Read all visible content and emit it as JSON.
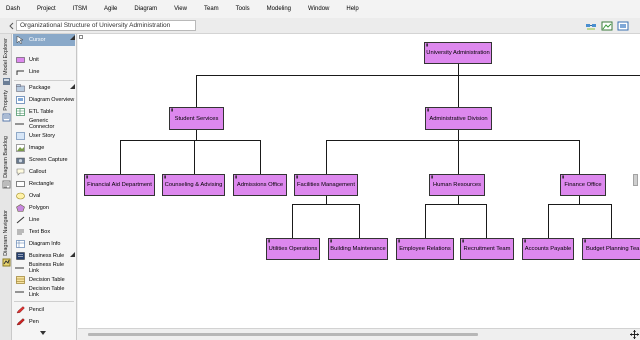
{
  "menu": [
    "Dash",
    "Project",
    "ITSM",
    "Agile",
    "Diagram",
    "View",
    "Team",
    "Tools",
    "Modeling",
    "Window",
    "Help"
  ],
  "diagram_title": "Organizational Structure of University Administration",
  "side_tabs": [
    "Model Explorer",
    "Property",
    "Diagram Backlog",
    "Diagram Navigator"
  ],
  "palette": {
    "selected": "Cursor",
    "items": [
      "Cursor",
      "Unit",
      "Line",
      "Package",
      "Diagram Overview",
      "ETL Table",
      "Generic Connector",
      "User Story",
      "Image",
      "Screen Capture",
      "Callout",
      "Rectangle",
      "Oval",
      "Polygon",
      "Line",
      "Text Box",
      "Diagram Info",
      "Business Rule",
      "Business Rule Link",
      "Decision Table",
      "Decision Table Link",
      "Pencil",
      "Pen"
    ]
  },
  "colors": {
    "unit_fill": "#dd88ee",
    "selected": "#8aa9c9"
  },
  "org": {
    "root": "University Administration",
    "divisions": [
      "Student Services",
      "Administrative Division"
    ],
    "student_services": [
      "Financial Aid Department",
      "Counseling & Advising",
      "Admissions Office"
    ],
    "administrative": [
      "Facilities Management",
      "Human Resources",
      "Finance Office"
    ],
    "facilities": [
      "Utilities Operations",
      "Building Maintenance"
    ],
    "hr": [
      "Employee Relations",
      "Recruitment Team"
    ],
    "finance": [
      "Accounts Payable",
      "Budget Planning Tea"
    ]
  }
}
